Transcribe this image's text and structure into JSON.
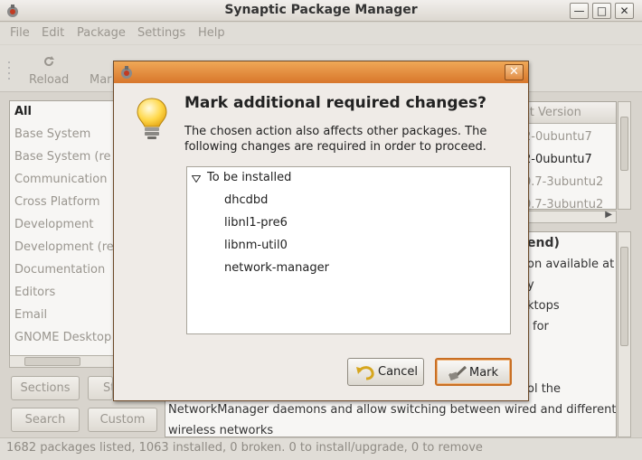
{
  "window": {
    "title": "Synaptic Package Manager"
  },
  "menu": [
    "File",
    "Edit",
    "Package",
    "Settings",
    "Help"
  ],
  "toolbar": {
    "reload": "Reload",
    "mark_partial": "Mar"
  },
  "categories": [
    "All",
    "Base System",
    "Base System (re",
    "Communication",
    "Cross Platform",
    "Development",
    "Development (re",
    "Documentation",
    "Editors",
    "Email",
    "GNOME Desktop"
  ],
  "side_buttons": {
    "sections": "Sections",
    "status_partial": "St",
    "search": "Search",
    "custom": "Custom"
  },
  "package_list": {
    "header_partial": "st Version",
    "rows": [
      "2-0ubuntu7",
      "2-0ubuntu7",
      "0.7-3ubuntu2",
      "0.7-3ubuntu2"
    ]
  },
  "description": {
    "title_partial": "end)",
    "lines": [
      "on available at",
      "y",
      "ktops",
      "for",
      "ol the",
      "NetworkManager daemons and allow switching between wired and different",
      "wireless networks"
    ]
  },
  "status": "1682 packages listed, 1063 installed, 0 broken. 0 to install/upgrade, 0 to remove",
  "dialog": {
    "heading": "Mark additional required changes?",
    "message_line1": "The chosen action also affects other packages. The",
    "message_line2": "following changes are required in order to proceed.",
    "group": "To be installed",
    "packages": [
      "dhcdbd",
      "libnl1-pre6",
      "libnm-util0",
      "network-manager"
    ],
    "cancel": "Cancel",
    "mark": "Mark",
    "accent": "#d8762b"
  },
  "icons": {
    "app": "synaptic-icon",
    "bulb": "lightbulb-icon",
    "cancel": "undo-arrow-icon",
    "mark": "checkmark-icon",
    "reload": "reload-icon"
  }
}
